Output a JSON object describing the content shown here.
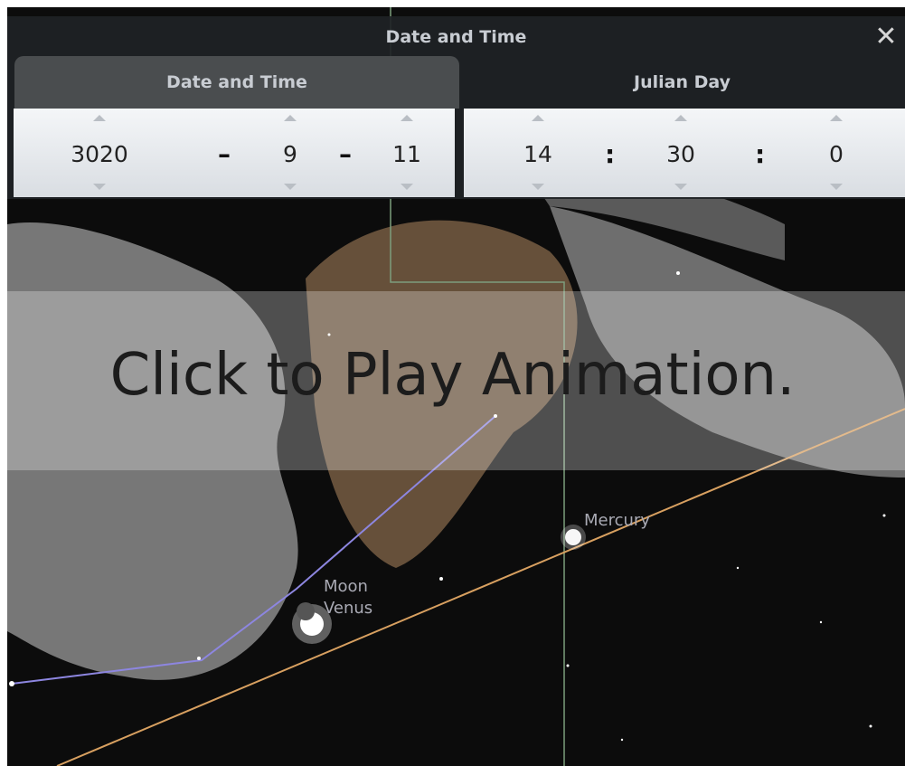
{
  "dialog": {
    "title": "Date and Time",
    "close_icon": "close-icon",
    "tabs": [
      {
        "label": "Date and Time",
        "active": true
      },
      {
        "label": "Julian Day",
        "active": false
      }
    ],
    "date": {
      "year": "3020",
      "month": "9",
      "day": "11",
      "separator": "–"
    },
    "time": {
      "hour": "14",
      "minute": "30",
      "second": "0",
      "separator": ":"
    }
  },
  "overlay": {
    "text": "Click to Play Animation."
  },
  "sky": {
    "labels": {
      "mercury": "Mercury",
      "moon": "Moon",
      "venus": "Venus"
    },
    "colors": {
      "background": "#0c0c0c",
      "ecliptic": "#d8a060",
      "constellation_line": "#8d86e0",
      "boundary": "#7d9e7d"
    }
  }
}
